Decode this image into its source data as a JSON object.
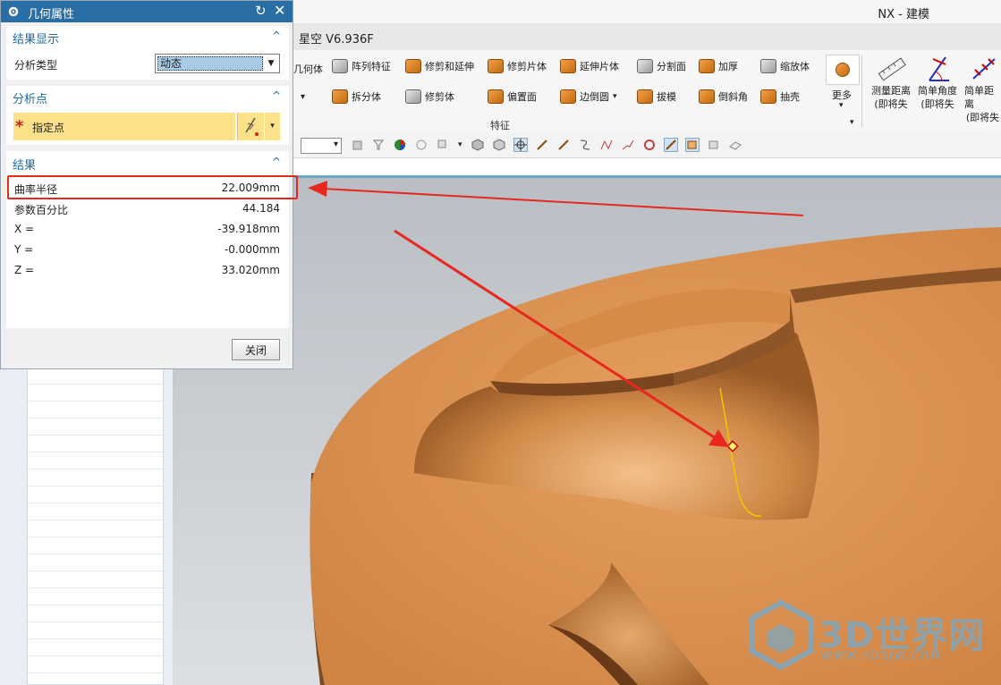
{
  "app": {
    "title": "NX - 建模",
    "version_tab": "星空 V6.936F"
  },
  "ribbon": {
    "row1": [
      "几何体",
      "阵列特征",
      "修剪和延伸",
      "修剪片体",
      "延伸片体",
      "分割面",
      "加厚",
      "缩放体"
    ],
    "row2": [
      "拆分体",
      "修剪体",
      "偏置面",
      "边倒圆",
      "拔模",
      "倒斜角",
      "抽壳"
    ],
    "more": "更多",
    "group_label": "特征",
    "right_tools": [
      {
        "l1": "测量距离",
        "l2": "(即将失"
      },
      {
        "l1": "简单角度",
        "l2": "(即将失"
      },
      {
        "l1": "简单距离",
        "l2": "(即将失"
      }
    ]
  },
  "dialog": {
    "title": "几何属性",
    "display_section": {
      "header": "结果显示",
      "type_label": "分析类型",
      "type_value": "动态"
    },
    "point_section": {
      "header": "分析点",
      "specify_point": "指定点"
    },
    "result_section": {
      "header": "结果",
      "rows": [
        {
          "label": "曲率半径",
          "value": "22.009mm"
        },
        {
          "label": "参数百分比",
          "value": "44.184"
        },
        {
          "label": "X =",
          "value": "-39.918mm"
        },
        {
          "label": "Y =",
          "value": "-0.000mm"
        },
        {
          "label": "Z =",
          "value": "33.020mm"
        }
      ]
    },
    "close_button": "关闭"
  },
  "watermark": {
    "brand": "3D世界网",
    "url": "WWW.3DSJW.COM"
  },
  "colors": {
    "model": "#d98a45",
    "highlight": "#e8281e",
    "dialog_header": "#2a6ea6",
    "section_header": "#1e6aa8",
    "point_field": "#fde08a"
  }
}
